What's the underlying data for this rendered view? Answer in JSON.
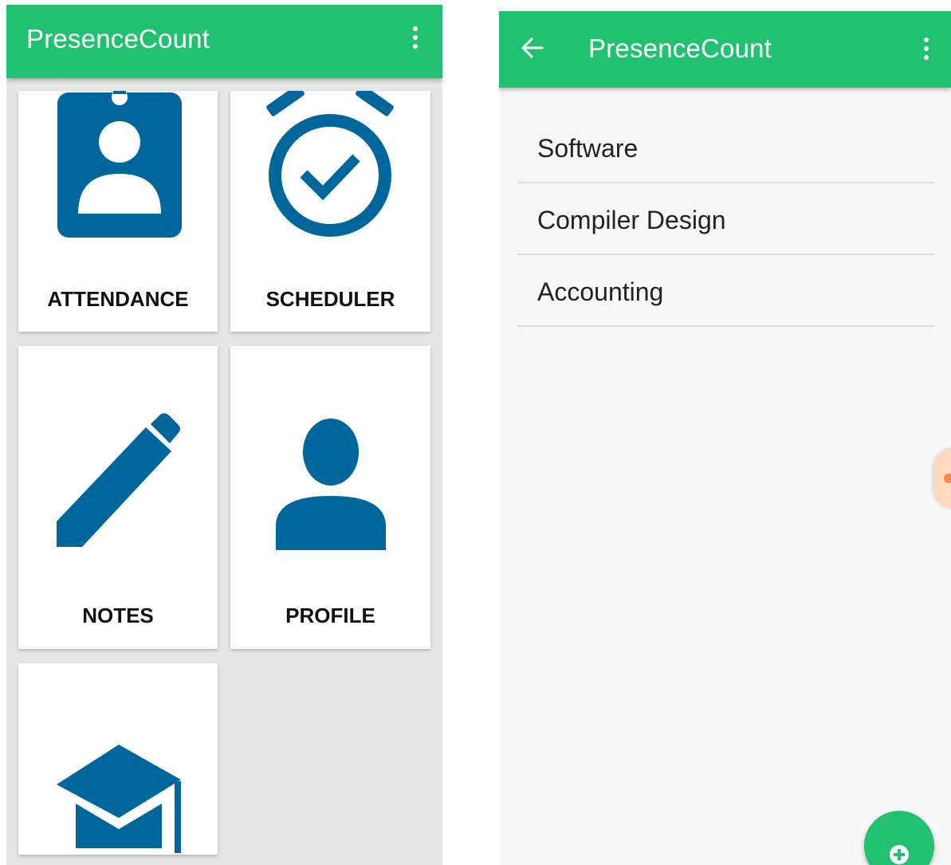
{
  "left_screen": {
    "app_bar": {
      "title": "PresenceCount"
    },
    "tiles": [
      {
        "label": "ATTENDANCE",
        "icon": "id-badge-icon"
      },
      {
        "label": "SCHEDULER",
        "icon": "alarm-check-icon"
      },
      {
        "label": "NOTES",
        "icon": "pencil-icon"
      },
      {
        "label": "PROFILE",
        "icon": "person-icon"
      },
      {
        "label": "",
        "icon": "graduation-cap-icon"
      }
    ]
  },
  "right_screen": {
    "app_bar": {
      "title": "PresenceCount"
    },
    "subjects": [
      {
        "label": "Software"
      },
      {
        "label": "Compiler Design"
      },
      {
        "label": "Accounting"
      }
    ],
    "fab": {
      "icon": "add-circle-icon"
    }
  },
  "colors": {
    "app_bar": "#21c171",
    "tile_icon": "#00679d",
    "grid_background": "#e6e6e6",
    "list_background": "#f7f7f7"
  }
}
